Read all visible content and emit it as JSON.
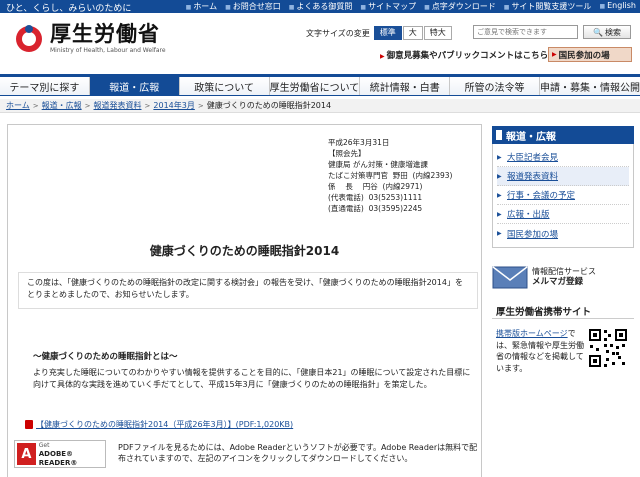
{
  "header": {
    "tagline": "ひと、くらし、みらいのために",
    "links": [
      "ホーム",
      "お問合せ窓口",
      "よくある御質問",
      "サイトマップ",
      "点字ダウンロード",
      "サイト閲覧支援ツール",
      "English"
    ],
    "logo_title": "厚生労働省",
    "logo_subtitle": "Ministry of Health, Labour and Welfare",
    "fontsize_label": "文字サイズの変更",
    "fontsize_options": [
      "標準",
      "大",
      "特大"
    ],
    "search_placeholder": "ご意見で検索できます",
    "search_button": "検索",
    "opinion_link": "御意見募集やパブリックコメントはこちら",
    "participate_button": "国民参加の場"
  },
  "nav": {
    "items": [
      "テーマ別に探す",
      "報道・広報",
      "政策について",
      "厚生労働省について",
      "統計情報・白書",
      "所管の法令等",
      "申請・募集・情報公開"
    ],
    "active_index": 1
  },
  "breadcrumb": [
    "ホーム",
    "報道・広報",
    "報道発表資料",
    "2014年3月",
    "健康づくりのための睡眠指針2014"
  ],
  "main": {
    "contact_block": "平成26年3月31日\n【照会先】\n健康局 がん対策・健康増進課\nたばこ対策専門官  野田  (内線2393)\n係　 長　 円谷  (内線2971)\n(代表電話)  03(5253)1111\n(直通電話)  03(3595)2245",
    "title": "健康づくりのための睡眠指針2014",
    "intro": "この度は、「健康づくりのための睡眠指針の改定に関する検討会」の報告を受け、「健康づくりのための睡眠指針2014」をとりまとめましたので、お知らせいたします。",
    "section_heading": "～健康づくりのための睡眠指針とは～",
    "section_text": "より充実した睡眠についてのわかりやすい情報を提供することを目的に、「健康日本21」の睡眠について設定された目標に向けて具体的な実践を進めていく手だてとして、平成15年3月に「健康づくりのための睡眠指針」を策定した。",
    "pdf_link": "【健康づくりのための睡眠指針2014（平成26年3月）】(PDF:1,020KB)",
    "adobe_get": "Get",
    "adobe_product": "ADOBE® READER®",
    "adobe_note": "PDFファイルを見るためには、Adobe Readerというソフトが必要です。Adobe Readerは無料で配布されていますので、左記のアイコンをクリックしてダウンロードしてください。"
  },
  "sidebar": {
    "heading": "報道・広報",
    "items": [
      "大臣記者会見",
      "報道発表資料",
      "行事・会議の予定",
      "広報・出版",
      "国民参加の場"
    ],
    "active_index": 1,
    "mail_line1": "情報配信サービス",
    "mail_line2": "メルマガ登録",
    "mobile_title": "厚生労働省携帯サイト",
    "mobile_link": "携帯版ホームページ",
    "mobile_text": "では、緊急情報や厚生労働省の情報などを掲載しています。"
  },
  "colors": {
    "primary_blue": "#134b96",
    "link_blue": "#1a4f98",
    "adobe_red": "#d01f1f"
  }
}
